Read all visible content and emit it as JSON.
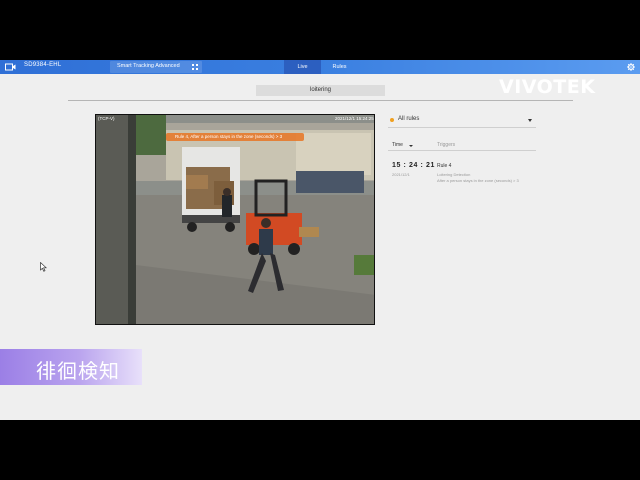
{
  "header": {
    "model": "SD9384-EHL",
    "app_selector": "Smart Tracking Advanced",
    "tabs": [
      {
        "label": "Live",
        "active": true
      },
      {
        "label": "Rules",
        "active": false
      }
    ]
  },
  "page": {
    "section_tab": "loitering",
    "brand": "VIVOTEK"
  },
  "video": {
    "stream": "(TCP-V)",
    "timestamp": "2021/12/1 15:24:25",
    "rule_overlay": "Rule 4, After a person stays in the zone (seconds) > 3"
  },
  "rules_panel": {
    "filter": "All rules",
    "columns": {
      "time": "Time",
      "triggers": "Triggers"
    },
    "events": [
      {
        "time": "15 : 24 : 21",
        "date": "2021/12/1",
        "rule": "Rule 4",
        "type": "Loitering Detection",
        "description": "After a person stays in the zone (seconds) > 3"
      }
    ]
  },
  "caption": {
    "text": "徘徊検知"
  },
  "colors": {
    "topbar": "#3a7fe0",
    "active_tab": "#2c5fc0",
    "rule_overlay": "#e67828",
    "filter_dot": "#f0a020",
    "caption_purple": "#9b7fe6"
  }
}
